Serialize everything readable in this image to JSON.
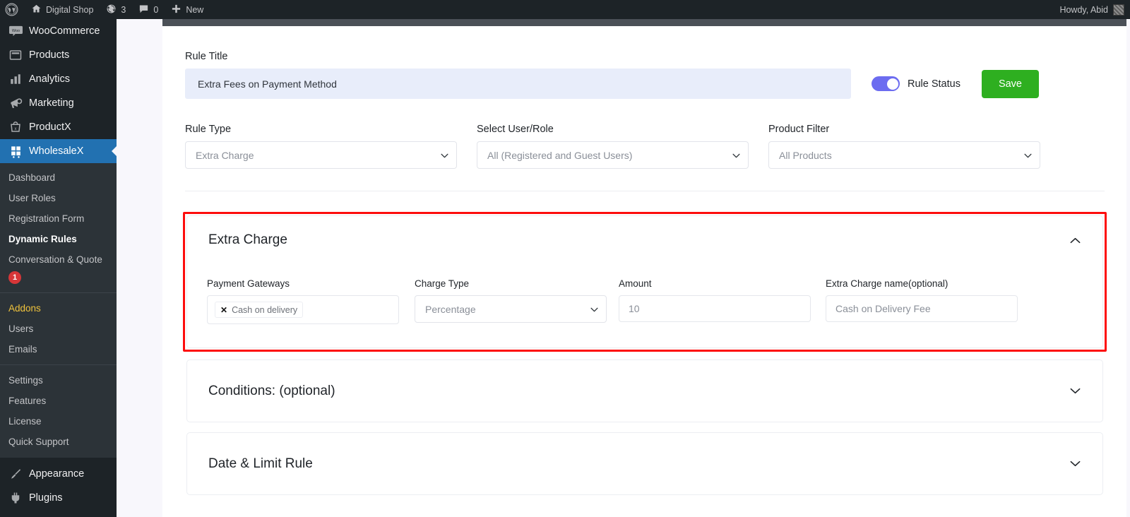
{
  "adminbar": {
    "wp_logo": "wordpress-logo",
    "site_name": "Digital Shop",
    "updates_count": "3",
    "comments_count": "0",
    "new_label": "New",
    "howdy": "Howdy, Abid"
  },
  "sidebar": {
    "top_items": [
      {
        "label": "WooCommerce",
        "icon": "woocommerce-icon",
        "current": false
      },
      {
        "label": "Products",
        "icon": "products-icon",
        "current": false
      },
      {
        "label": "Analytics",
        "icon": "analytics-icon",
        "current": false
      },
      {
        "label": "Marketing",
        "icon": "marketing-icon",
        "current": false
      },
      {
        "label": "ProductX",
        "icon": "productx-icon",
        "current": false
      },
      {
        "label": "WholesaleX",
        "icon": "wholesalex-icon",
        "current": true
      }
    ],
    "submenu": [
      {
        "label": "Dashboard",
        "state": "normal"
      },
      {
        "label": "User Roles",
        "state": "normal"
      },
      {
        "label": "Registration Form",
        "state": "normal"
      },
      {
        "label": "Dynamic Rules",
        "state": "current"
      },
      {
        "label": "Conversation & Quote",
        "state": "normal",
        "badge": "1"
      },
      {
        "label": "Addons",
        "state": "addons"
      },
      {
        "label": "Users",
        "state": "normal"
      },
      {
        "label": "Emails",
        "state": "normal"
      },
      {
        "label": "Settings",
        "state": "normal"
      },
      {
        "label": "Features",
        "state": "normal"
      },
      {
        "label": "License",
        "state": "normal"
      },
      {
        "label": "Quick Support",
        "state": "normal"
      }
    ],
    "bottom_items": [
      {
        "label": "Appearance",
        "icon": "appearance-icon"
      },
      {
        "label": "Plugins",
        "icon": "plugins-icon"
      }
    ]
  },
  "rule": {
    "title_label": "Rule Title",
    "title_value": "Extra Fees on Payment Method",
    "title_placeholder": "Rule Title",
    "status_label": "Rule Status",
    "status_on": true,
    "save_label": "Save",
    "fields": [
      {
        "label": "Rule Type",
        "value": "Extra Charge"
      },
      {
        "label": "Select User/Role",
        "value": "All (Registered and Guest Users)"
      },
      {
        "label": "Product Filter",
        "value": "All Products"
      }
    ]
  },
  "extra_charge": {
    "title": "Extra Charge",
    "expanded": true,
    "payment_gateways_label": "Payment Gateways",
    "payment_gateway_chip": "Cash on delivery",
    "charge_type_label": "Charge Type",
    "charge_type_value": "Percentage",
    "amount_label": "Amount",
    "amount_value": "10",
    "name_label": "Extra Charge name(optional)",
    "name_value": "Cash on Delivery Fee"
  },
  "accordions": [
    {
      "title": "Conditions: (optional)",
      "expanded": false
    },
    {
      "title": "Date & Limit Rule",
      "expanded": false
    }
  ],
  "colors": {
    "admin_dark": "#1d2327",
    "submenu_dark": "#2c3338",
    "active_blue": "#2271b1",
    "addons_yellow": "#f0c33c",
    "toggle_purple": "#6c6cf0",
    "save_green": "#2eaf20",
    "highlight_red": "#fd0d0d",
    "title_field_bg": "#e8edfa",
    "badge_red": "#d63638",
    "page_bg": "#f8f7fc"
  }
}
